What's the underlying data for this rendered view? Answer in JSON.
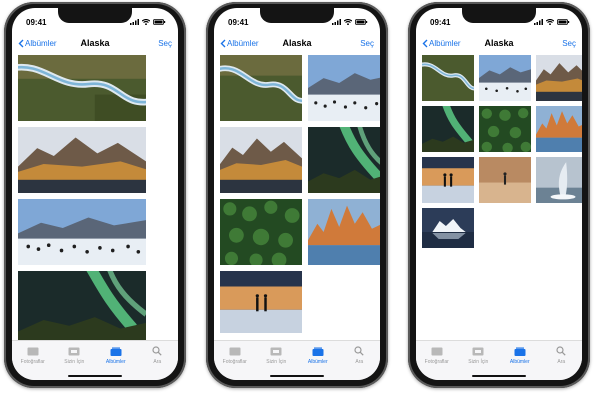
{
  "status": {
    "time": "09:41"
  },
  "nav": {
    "back_label": "Albümler",
    "title": "Alaska",
    "select_label": "Seç"
  },
  "tabs": [
    {
      "label": "Fotoğraflar",
      "icon": "photos-icon",
      "active": false
    },
    {
      "label": "Sizin İçin",
      "icon": "for-you-icon",
      "active": false
    },
    {
      "label": "Albümler",
      "icon": "albums-icon",
      "active": true
    },
    {
      "label": "Ara",
      "icon": "search-icon",
      "active": false
    }
  ],
  "photos": [
    {
      "subject": "braided-river-aerial"
    },
    {
      "subject": "mountain-range-sunset"
    },
    {
      "subject": "penguin-colony-mountains"
    },
    {
      "subject": "aurora-borealis"
    },
    {
      "subject": "forest-canopy-aerial"
    },
    {
      "subject": "jagged-peaks-sunrise"
    },
    {
      "subject": "couple-at-sunset"
    },
    {
      "subject": "lone-figure-desert"
    },
    {
      "subject": "breaching-whale"
    },
    {
      "subject": "iceberg-lagoon"
    }
  ],
  "colors": {
    "accent": "#1a73e8",
    "phone_body": "#141414",
    "tab_bar": "#f6f6f8"
  }
}
